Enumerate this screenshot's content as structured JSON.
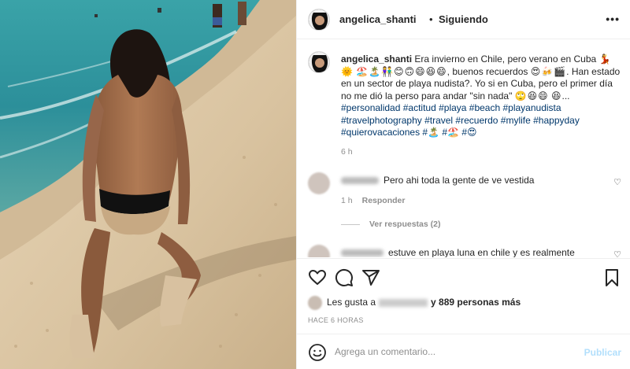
{
  "header": {
    "username": "angelica_shanti",
    "separator": "•",
    "follow_status": "Siguiendo",
    "more_icon": "more-horizontal-icon"
  },
  "caption": {
    "username": "angelica_shanti",
    "text1": "Era invierno en Chile, pero verano en Cuba",
    "emoji1": "💃🌞",
    "emoji2": "🏖️🏝️👫😊🙃😄😆😄",
    "text2": ", buenos recuerdos",
    "emoji3": "😍🍻🎬",
    "text3": ". Han estado en un sector de playa nudista?. Yo si en Cuba, pero el primer día no me dió la perso para andar \"sin nada\"",
    "emoji4": "🙄😆😄",
    "emoji5": "😆",
    "ellipsis": "...",
    "hashtags": "#personalidad #actitud #playa #beach #playanudista #travelphotography #travel #recuerdo #mylife #happyday #quierovacaciones",
    "tail_emoji1": "#🏝️",
    "tail_emoji2": "#🏖️",
    "tail_emoji3": "#😍",
    "time": "6 h"
  },
  "comments": [
    {
      "text": "Pero ahi toda la gente de ve vestida",
      "time": "1 h",
      "reply_label": "Responder"
    },
    {
      "text": "estuve en playa luna en chile y es realmente"
    }
  ],
  "replies_label": "Ver respuestas (2)",
  "actions": {
    "like_icon": "heart-icon",
    "comment_icon": "comment-icon",
    "share_icon": "paper-plane-icon",
    "save_icon": "bookmark-icon"
  },
  "likes": {
    "prefix": "Les gusta a",
    "rest": "y 889 personas más"
  },
  "posted_ago": "HACE 6 HORAS",
  "add_comment": {
    "placeholder": "Agrega un comentario...",
    "publish_label": "Publicar"
  },
  "colors": {
    "link": "#00376b",
    "muted": "#8e8e8e",
    "publish_disabled": "#b2dffc",
    "border": "#efefef"
  }
}
